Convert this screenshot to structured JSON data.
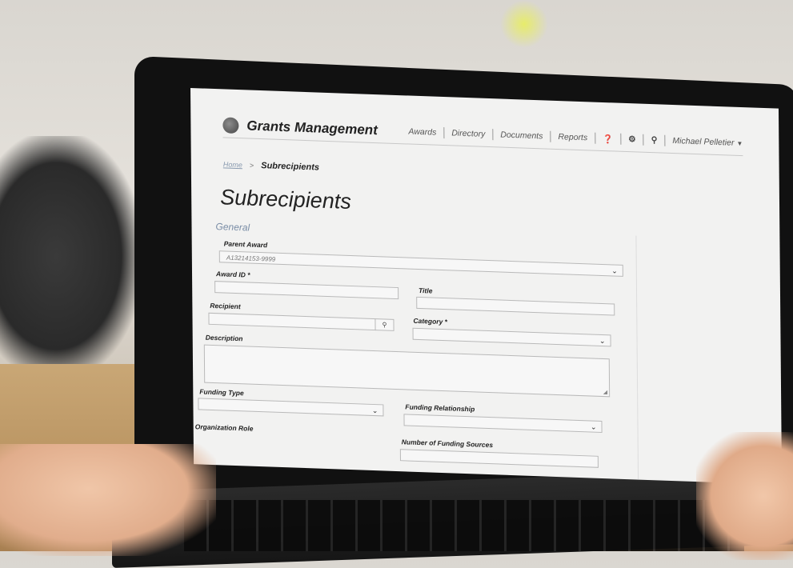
{
  "header": {
    "app_title": "Grants Management",
    "nav": {
      "awards": "Awards",
      "directory": "Directory",
      "documents": "Documents",
      "reports": "Reports",
      "user": "Michael Pelletier"
    },
    "icons": [
      "help-icon",
      "gear-icon",
      "search-icon"
    ]
  },
  "breadcrumb": {
    "home": "Home",
    "separator": ">",
    "current": "Subrecipients"
  },
  "page": {
    "title": "Subrecipients",
    "section": "General"
  },
  "form": {
    "parent_award": {
      "label": "Parent Award",
      "value": "A13214153-9999"
    },
    "award_id": {
      "label": "Award ID *",
      "value": ""
    },
    "title": {
      "label": "Title",
      "value": ""
    },
    "recipient": {
      "label": "Recipient",
      "value": ""
    },
    "category": {
      "label": "Category *",
      "value": ""
    },
    "description": {
      "label": "Description",
      "value": ""
    },
    "funding_type": {
      "label": "Funding Type",
      "value": ""
    },
    "funding_relationship": {
      "label": "Funding Relationship",
      "value": ""
    },
    "organization_role": {
      "label": "Organization Role"
    },
    "number_of_funding_sources": {
      "label": "Number of Funding Sources"
    }
  }
}
